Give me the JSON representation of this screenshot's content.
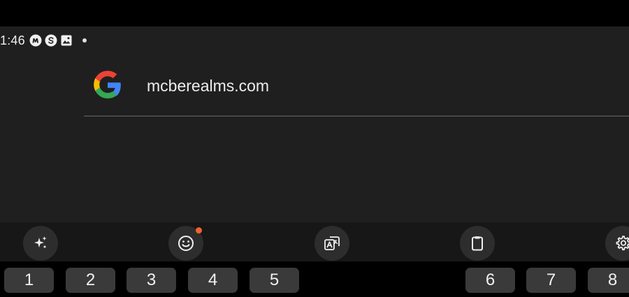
{
  "status_bar": {
    "time": "1:46",
    "icons": [
      "m-notification-icon",
      "s-notification-icon",
      "image-notification-icon"
    ],
    "more_indicator": "dot"
  },
  "search": {
    "provider_icon": "google-g-icon",
    "query": "mcberealms.com"
  },
  "keyboard_toolbar": {
    "tools": [
      {
        "name": "ai-sparkle-icon"
      },
      {
        "name": "emoji-icon",
        "has_badge": true,
        "badge_color": "#f0642c"
      },
      {
        "name": "translate-icon"
      },
      {
        "name": "clipboard-icon"
      },
      {
        "name": "settings-gear-icon"
      }
    ]
  },
  "number_row": {
    "keys": [
      "1",
      "2",
      "3",
      "4",
      "5",
      "6",
      "7",
      "8"
    ]
  },
  "colors": {
    "background": "#1f1f1f",
    "toolbar": "#171717",
    "key": "#3a3a3a",
    "badge": "#f0642c"
  }
}
